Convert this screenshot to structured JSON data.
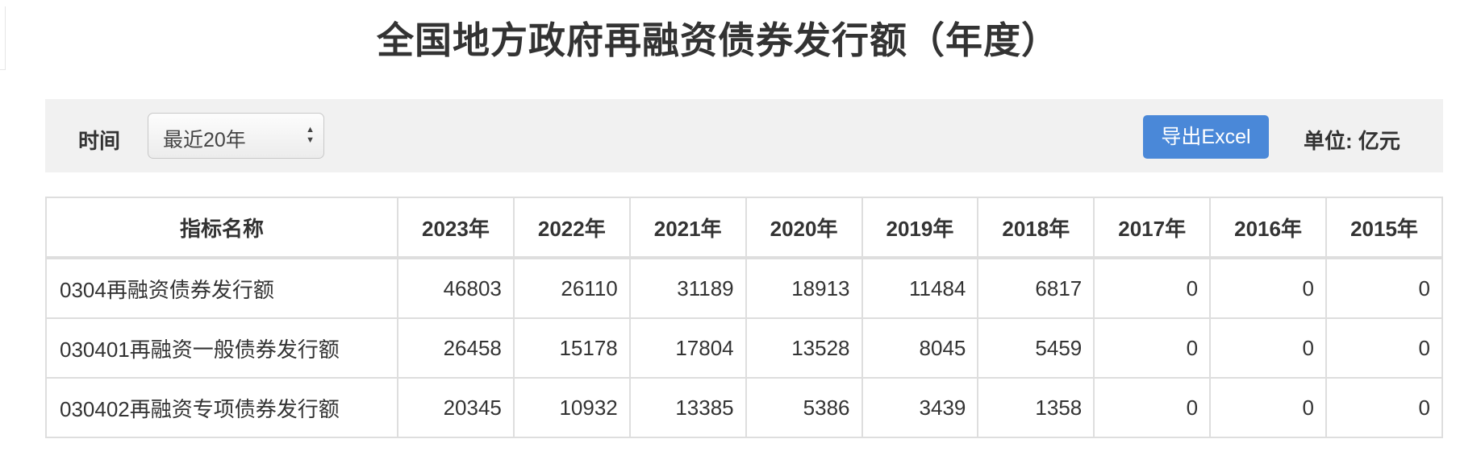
{
  "title": "全国地方政府再融资债券发行额（年度）",
  "toolbar": {
    "time_label": "时间",
    "time_select": {
      "value": "最近20年"
    },
    "export_label": "导出Excel",
    "unit_label": "单位: 亿元",
    "export_color": "#4a88d8"
  },
  "table": {
    "headers": [
      "指标名称",
      "2023年",
      "2022年",
      "2021年",
      "2020年",
      "2019年",
      "2018年",
      "2017年",
      "2016年",
      "2015年"
    ],
    "rows": [
      {
        "name": "0304再融资债券发行额",
        "values": [
          "46803",
          "26110",
          "31189",
          "18913",
          "11484",
          "6817",
          "0",
          "0",
          "0"
        ]
      },
      {
        "name": "030401再融资一般债券发行额",
        "values": [
          "26458",
          "15178",
          "17804",
          "13528",
          "8045",
          "5459",
          "0",
          "0",
          "0"
        ]
      },
      {
        "name": "030402再融资专项债券发行额",
        "values": [
          "20345",
          "10932",
          "13385",
          "5386",
          "3439",
          "1358",
          "0",
          "0",
          "0"
        ]
      }
    ]
  }
}
